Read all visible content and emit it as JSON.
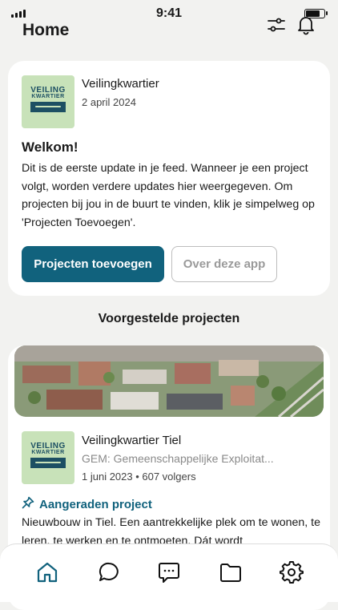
{
  "status_bar": {
    "time": "9:41",
    "battery_level": 0.85,
    "signal_bars": 4
  },
  "header": {
    "title": "Home",
    "filter_icon": "sliders-icon",
    "notifications_icon": "bell-icon"
  },
  "welcome_card": {
    "source": {
      "name": "Veilingkwartier",
      "date": "2 april 2024",
      "logo_line1": "VEILING",
      "logo_line2": "KWARTIER"
    },
    "title": "Welkom!",
    "body": "Dit is de eerste update in je feed. Wanneer je een project volgt, worden verdere updates hier weergegeven. Om projecten bij jou in de buurt te vinden, klik je simpelweg op 'Projecten Toevoegen'.",
    "primary_button": "Projecten toevoegen",
    "secondary_button": "Over deze app"
  },
  "suggested": {
    "section_title": "Voorgestelde projecten",
    "project": {
      "name": "Veilingkwartier Tiel",
      "organization": "GEM: Gemeenschappelijke Exploitat...",
      "meta": "1 juni 2023 • 607 volgers",
      "tag": "Aangeraden project",
      "description": "Nieuwbouw in Tiel. Een aantrekkelijke plek om te wonen, te leren, te werken en te ontmoeten. Dát wordt",
      "logo_line1": "VEILING",
      "logo_line2": "KWARTIER"
    }
  },
  "tab_bar": {
    "items": [
      {
        "icon": "home-icon",
        "active": true
      },
      {
        "icon": "chat-icon",
        "active": false
      },
      {
        "icon": "message-icon",
        "active": false
      },
      {
        "icon": "folder-icon",
        "active": false
      },
      {
        "icon": "settings-icon",
        "active": false
      }
    ]
  },
  "colors": {
    "accent": "#11627d",
    "logo_bg": "#c8e2b9",
    "logo_ink": "#1c4f63",
    "background": "#f2f2f0"
  }
}
